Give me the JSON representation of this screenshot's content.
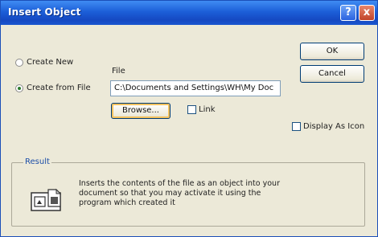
{
  "window": {
    "title": "Insert Object",
    "help_glyph": "?",
    "close_glyph": "x"
  },
  "options": {
    "create_new": "Create New",
    "create_from_file": "Create from File",
    "selected": "Create from File"
  },
  "file": {
    "label": "File",
    "path": "C:\\Documents and Settings\\WH\\My Doc",
    "browse_label": "Browse...",
    "link_label": "Link",
    "link_checked": false
  },
  "buttons": {
    "ok": "OK",
    "cancel": "Cancel"
  },
  "display_as_icon": {
    "label": "Display As Icon",
    "checked": false
  },
  "result": {
    "label": "Result",
    "text": "Inserts the contents of the file as an object into your document so that you may activate it using the program which created it"
  }
}
